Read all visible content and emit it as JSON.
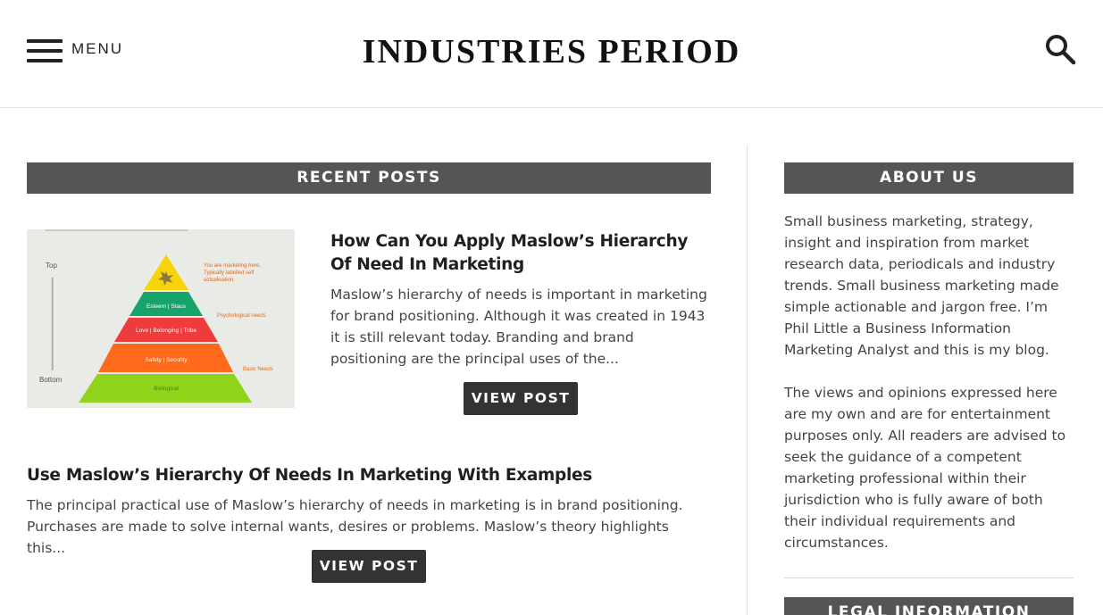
{
  "header": {
    "menu_label": "MENU",
    "site_title": "INDUSTRIES PERIOD"
  },
  "main": {
    "section_title": "RECENT POSTS",
    "posts": [
      {
        "title": "How Can You Apply Maslow’s Hierarchy Of Need In Marketing",
        "excerpt": "Maslow’s hierarchy of needs is important in marketing for brand positioning. Although it was created in 1943 it is still relevant today. Branding and brand positioning are the principal uses of the...",
        "button": "VIEW POST",
        "thumbnail": {
          "left_labels": [
            "Top",
            "Bottom"
          ],
          "levels": [
            "Esteem | Staus",
            "Love | Belonging | Tribe",
            "Safety | Security",
            "Biological"
          ],
          "right_labels": [
            "You are marketing here. Typically labelled self actualisation.",
            "Psychological needs",
            "Basic Needs"
          ]
        }
      },
      {
        "title": "Use Maslow’s Hierarchy Of Needs In Marketing With Examples",
        "excerpt": "The principal practical use of Maslow’s hierarchy of needs in marketing is in brand positioning. Purchases are made to solve internal wants, desires or problems. Maslow’s theory highlights this...",
        "button": "VIEW POST"
      }
    ]
  },
  "sidebar": {
    "about_title": "ABOUT US",
    "about_paragraphs": [
      "Small business marketing, strategy, insight and inspiration from market research data, periodicals and industry trends. Small business marketing made simple actionable and jargon free. I’m Phil Little a Business Information Marketing Analyst and this is my blog.",
      "The views and opinions expressed here are my own and are for entertainment purposes only. All readers are advised to seek the guidance of a competent marketing professional within their jurisdiction who is fully aware of both their individual requirements and circumstances."
    ],
    "legal_title": "LEGAL INFORMATION"
  },
  "colors": {
    "bar_bg": "#555555",
    "button_bg": "#333333",
    "pyramid": [
      "#f7d40a",
      "#17a36c",
      "#ee3b3b",
      "#ff6a1a",
      "#8fd31a"
    ]
  },
  "icons": {
    "menu": "hamburger-icon",
    "search": "search-icon",
    "star": "star-icon"
  }
}
